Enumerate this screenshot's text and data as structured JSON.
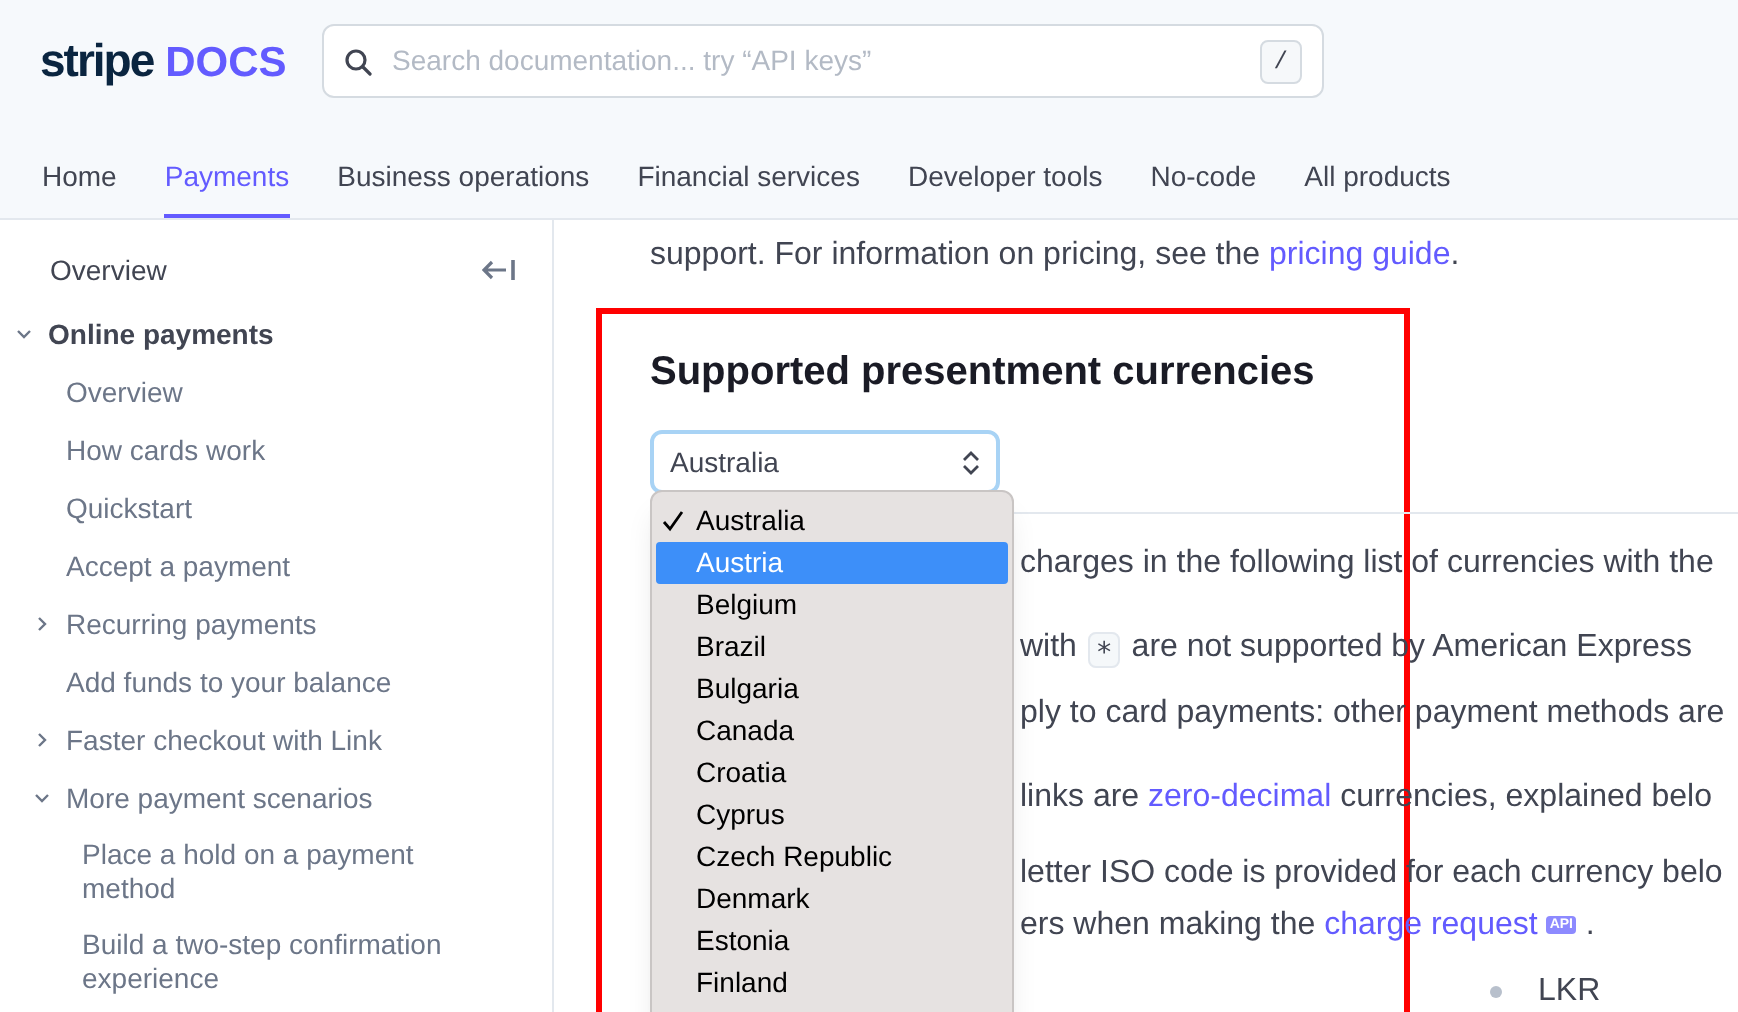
{
  "logo": {
    "brand": "stripe",
    "product": "DOCS"
  },
  "search": {
    "placeholder": "Search documentation... try “API keys”",
    "shortcut": "/"
  },
  "nav_tabs": [
    {
      "label": "Home",
      "selected": false
    },
    {
      "label": "Payments",
      "selected": true
    },
    {
      "label": "Business operations",
      "selected": false
    },
    {
      "label": "Financial services",
      "selected": false
    },
    {
      "label": "Developer tools",
      "selected": false
    },
    {
      "label": "No-code",
      "selected": false
    },
    {
      "label": "All products",
      "selected": false
    }
  ],
  "sidebar": {
    "top_item": "Overview",
    "items": [
      {
        "label": "Online payments",
        "kind": "group",
        "expanded": true,
        "children": [
          {
            "label": "Overview",
            "kind": "link"
          },
          {
            "label": "How cards work",
            "kind": "link"
          },
          {
            "label": "Quickstart",
            "kind": "link"
          },
          {
            "label": "Accept a payment",
            "kind": "link"
          },
          {
            "label": "Recurring payments",
            "kind": "group",
            "expanded": false
          },
          {
            "label": "Add funds to your balance",
            "kind": "link"
          },
          {
            "label": "Faster checkout with Link",
            "kind": "group",
            "expanded": false
          },
          {
            "label": "More payment scenarios",
            "kind": "group",
            "expanded": true,
            "children": [
              {
                "label": "Place a hold on a payment method",
                "kind": "link"
              },
              {
                "label": "Build a two-step confirmation experience",
                "kind": "link"
              }
            ]
          }
        ]
      }
    ]
  },
  "intro": [
    {
      "kind": "text",
      "text": "support. For information on pricing, see the "
    },
    {
      "kind": "link",
      "text": "pricing guide"
    },
    {
      "kind": "text",
      "text": "."
    }
  ],
  "heading": "Supported presentment currencies",
  "select": {
    "value": "Australia"
  },
  "dropdown_options": [
    {
      "label": "Australia",
      "checked": true,
      "highlighted": false
    },
    {
      "label": "Austria",
      "checked": false,
      "highlighted": true
    },
    {
      "label": "Belgium",
      "checked": false,
      "highlighted": false
    },
    {
      "label": "Brazil",
      "checked": false,
      "highlighted": false
    },
    {
      "label": "Bulgaria",
      "checked": false,
      "highlighted": false
    },
    {
      "label": "Canada",
      "checked": false,
      "highlighted": false
    },
    {
      "label": "Croatia",
      "checked": false,
      "highlighted": false
    },
    {
      "label": "Cyprus",
      "checked": false,
      "highlighted": false
    },
    {
      "label": "Czech Republic",
      "checked": false,
      "highlighted": false
    },
    {
      "label": "Denmark",
      "checked": false,
      "highlighted": false
    },
    {
      "label": "Estonia",
      "checked": false,
      "highlighted": false
    },
    {
      "label": "Finland",
      "checked": false,
      "highlighted": false
    }
  ],
  "body_lines": [
    [
      {
        "kind": "text",
        "text": "charges in the following list of currencies with the"
      }
    ],
    [
      {
        "kind": "text",
        "text": "with "
      },
      {
        "kind": "code",
        "text": "∗"
      },
      {
        "kind": "text",
        "text": " are not supported by American Express"
      }
    ],
    [
      {
        "kind": "text",
        "text": "ply to card payments: other payment methods are"
      }
    ],
    [
      {
        "kind": "text",
        "text": "links are "
      },
      {
        "kind": "link",
        "text": "zero-decimal"
      },
      {
        "kind": "text",
        "text": " currencies, explained belo"
      }
    ],
    [
      {
        "kind": "text",
        "text": "letter ISO code is provided for each currency belo"
      }
    ],
    [
      {
        "kind": "text",
        "text": "ers when making the "
      },
      {
        "kind": "link",
        "text": "charge request"
      },
      {
        "kind": "badge",
        "text": "API"
      },
      {
        "kind": "text",
        "text": " ."
      }
    ]
  ],
  "bullets": [
    "LKR"
  ],
  "annotation": {
    "kind": "frame"
  }
}
